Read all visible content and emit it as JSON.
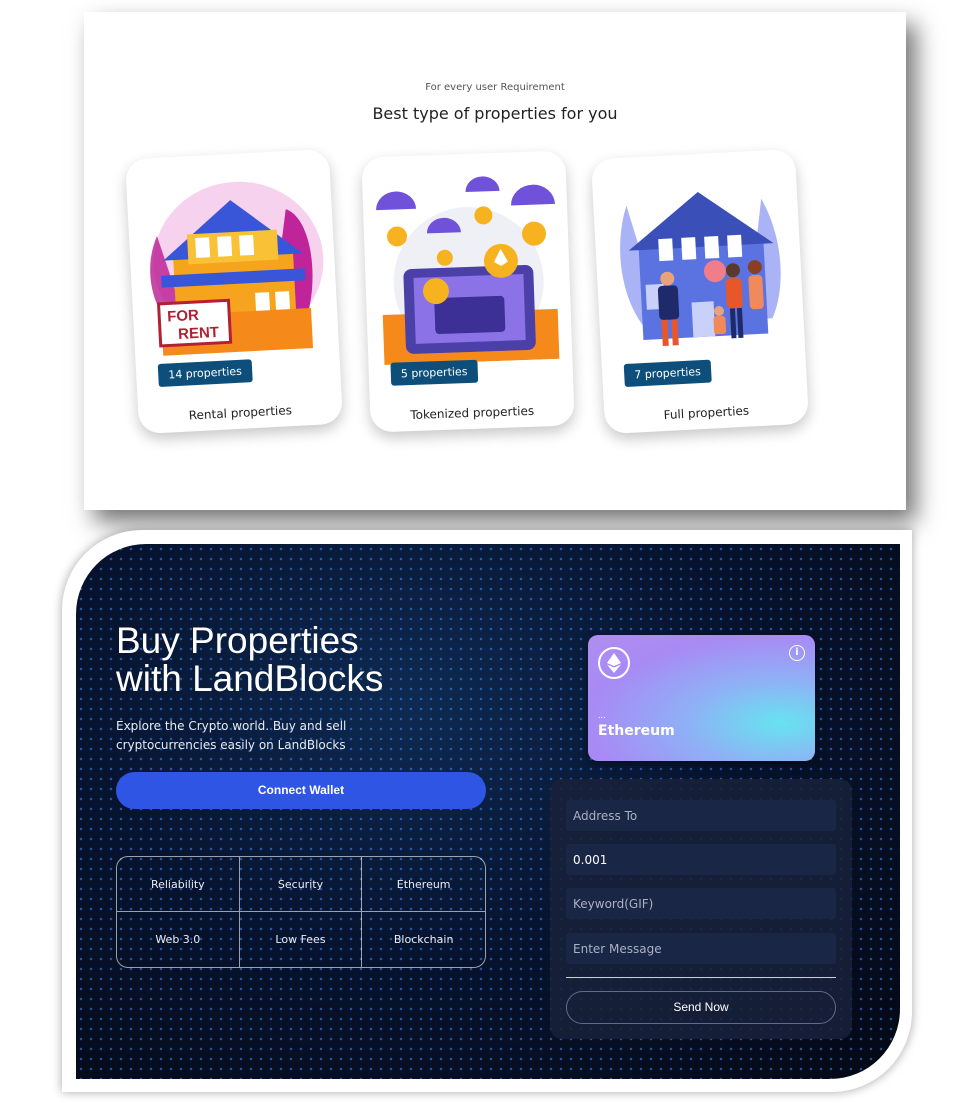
{
  "properties_section": {
    "eyebrow": "For every user Requirement",
    "title": "Best type of properties for you",
    "cards": [
      {
        "count": "14 properties",
        "label": "Rental properties",
        "sign_line1": "FOR",
        "sign_line2": "RENT"
      },
      {
        "count": "5 properties",
        "label": "Tokenized properties"
      },
      {
        "count": "7 properties",
        "label": "Full properties"
      }
    ]
  },
  "hero": {
    "title_line1": "Buy Properties",
    "title_line2": "with LandBlocks",
    "subtitle": "Explore the Crypto world. Buy and sell cryptocurrencies easily on LandBlocks",
    "connect_label": "Connect Wallet",
    "features": [
      "Reliability",
      "Security",
      "Ethereum",
      "Web 3.0",
      "Low Fees",
      "Blockchain"
    ]
  },
  "eth_card": {
    "address": "...",
    "network": "Ethereum",
    "info_glyph": "i"
  },
  "form": {
    "address_placeholder": "Address To",
    "amount_value": "0.001",
    "keyword_placeholder": "Keyword(GIF)",
    "message_placeholder": "Enter Message",
    "send_label": "Send Now"
  },
  "colors": {
    "badge": "#0d4f7a",
    "connect_button": "#2f55e4",
    "panel_dark": "#071430"
  }
}
